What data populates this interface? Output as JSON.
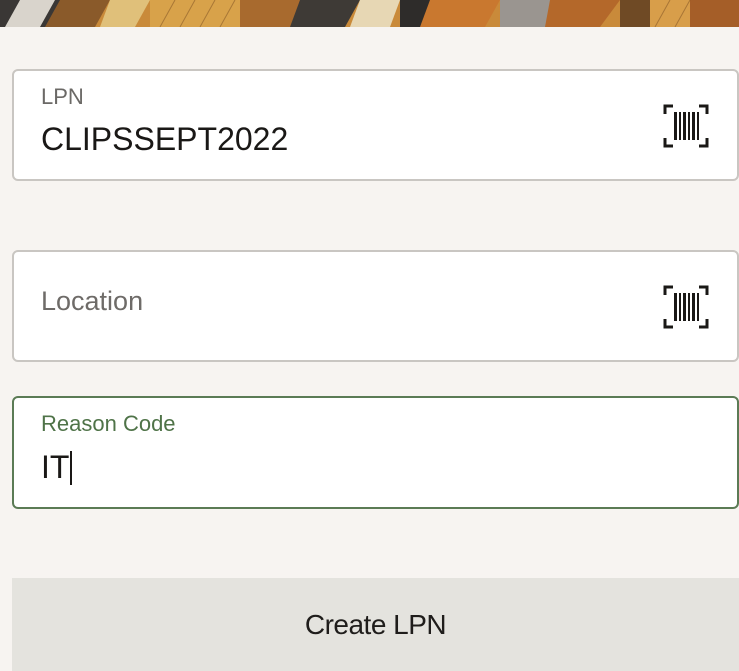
{
  "header": {
    "banner_icon": "decorative-pattern-banner"
  },
  "form": {
    "lpn": {
      "label": "LPN",
      "value": "CLIPSSEPT2022",
      "icon": "barcode-scan-icon"
    },
    "location": {
      "placeholder": "Location",
      "value": "",
      "icon": "barcode-scan-icon"
    },
    "reason_code": {
      "label": "Reason Code",
      "value": "IT"
    }
  },
  "actions": {
    "create_lpn_label": "Create LPN"
  },
  "colors": {
    "background": "#f7f4f1",
    "field_border": "#c9c6c2",
    "focused_border": "#5b7b55",
    "focused_label": "#4f7348",
    "action_bar": "#e4e3de"
  }
}
